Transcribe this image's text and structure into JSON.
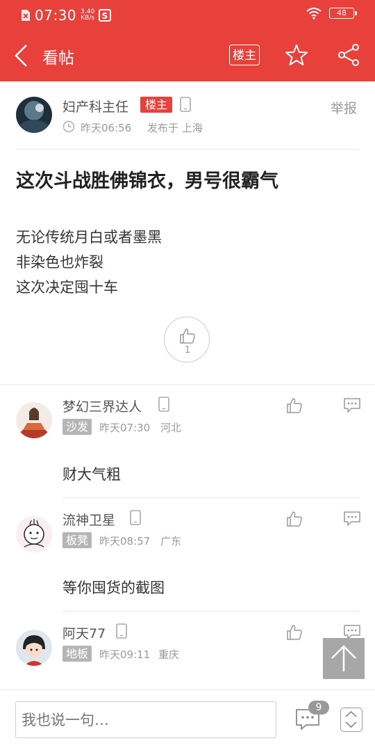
{
  "status_bar": {
    "time": "07:30",
    "speed_value": "3.40",
    "speed_unit": "KB/s",
    "battery": "48"
  },
  "nav": {
    "title": "看帖",
    "op_button": "楼主"
  },
  "post": {
    "author": "妇产科主任",
    "op_tag": "楼主",
    "time": "昨天06:56",
    "location": "发布于 上海",
    "report_label": "举报",
    "title": "这次斗战胜佛锦衣，男号很霸气",
    "body": [
      "无论传统月白或者墨黑",
      "非染色也炸裂",
      "这次决定囤十车"
    ],
    "likes": "1"
  },
  "replies": [
    {
      "author": "梦幻三界达人",
      "floor": "沙发",
      "time": "昨天07:30",
      "location": "河北",
      "text": "财大气粗"
    },
    {
      "author": "流神卫星",
      "floor": "板凳",
      "time": "昨天08:57",
      "location": "广东",
      "text": "等你囤货的截图"
    },
    {
      "author": "阿天77",
      "floor": "地板",
      "time": "昨天09:11",
      "location": "重庆",
      "text": ""
    }
  ],
  "bottom": {
    "input_placeholder": "我也说一句…",
    "comment_count": "9"
  },
  "colors": {
    "brand_red": "#e8413c",
    "tag_gray": "#b5b5b5"
  }
}
